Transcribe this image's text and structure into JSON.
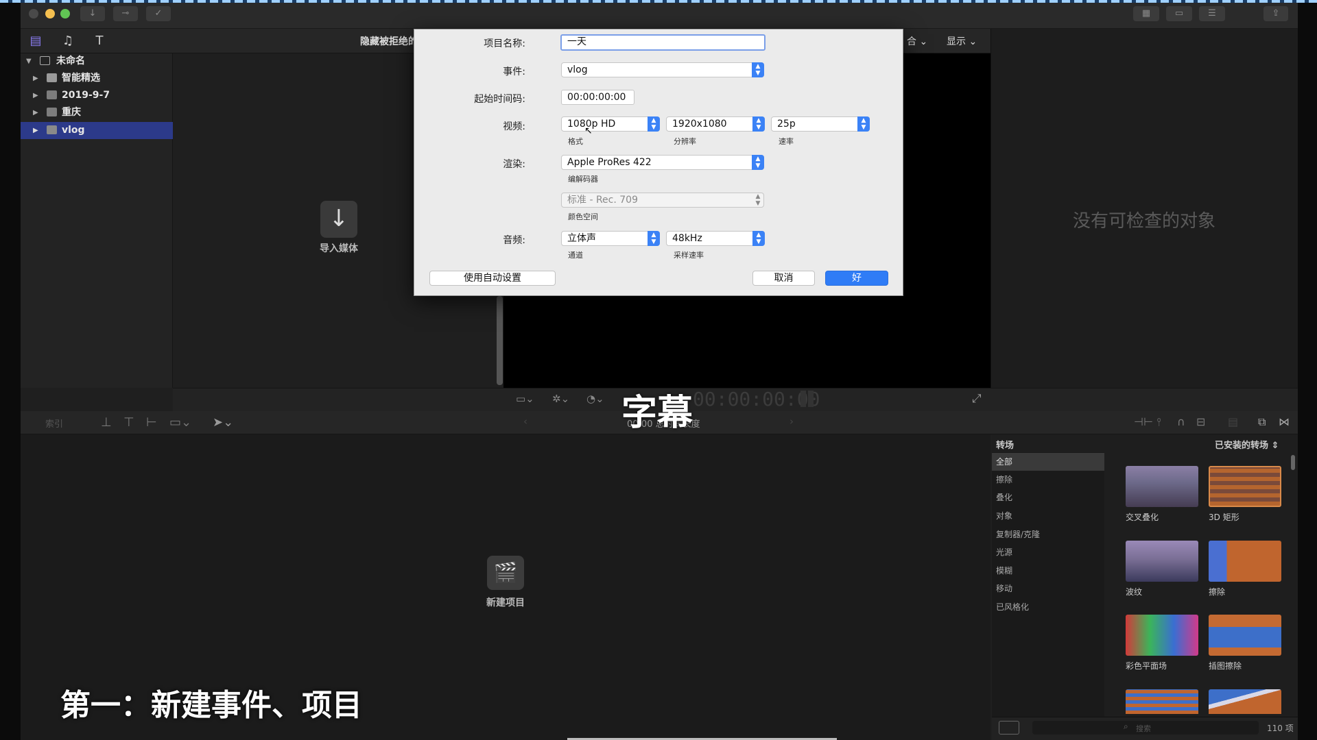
{
  "library": {
    "name": "未命名",
    "items": [
      {
        "label": "智能精选"
      },
      {
        "label": "2019-9-7"
      },
      {
        "label": "重庆"
      },
      {
        "label": "vlog"
      }
    ]
  },
  "browser": {
    "hide_rejected": "隐藏被拒绝的",
    "import_media": "导入媒体"
  },
  "viewer": {
    "combine": "合",
    "display": "显示",
    "timecode": "00:00:00:00",
    "duration": "00:00 总时间长度"
  },
  "inspector": {
    "empty": "没有可检查的对象"
  },
  "timeline": {
    "index": "索引",
    "new_project": "新建项目"
  },
  "dialog": {
    "project_name_label": "项目名称:",
    "project_name_value": "一天",
    "event_label": "事件:",
    "event_value": "vlog",
    "start_tc_label": "起始时间码:",
    "start_tc_value": "00:00:00:00",
    "video_label": "视频:",
    "video_format": "1080p HD",
    "video_format_sub": "格式",
    "video_resolution": "1920x1080",
    "video_resolution_sub": "分辨率",
    "video_rate": "25p",
    "video_rate_sub": "速率",
    "render_label": "渲染:",
    "render_codec": "Apple ProRes 422",
    "render_codec_sub": "编解码器",
    "color_space": "标准 - Rec. 709",
    "color_space_sub": "颜色空间",
    "audio_label": "音频:",
    "audio_channels": "立体声",
    "audio_channels_sub": "通道",
    "audio_rate": "48kHz",
    "audio_rate_sub": "采样速率",
    "auto_settings": "使用自动设置",
    "cancel": "取消",
    "ok": "好"
  },
  "transitions": {
    "title": "转场",
    "installed": "已安装的转场",
    "categories": [
      "全部",
      "擦除",
      "叠化",
      "对象",
      "复制器/克隆",
      "光源",
      "模糊",
      "移动",
      "已风格化"
    ],
    "thumbs": [
      {
        "label": "交叉叠化"
      },
      {
        "label": "3D 矩形"
      },
      {
        "label": "波纹"
      },
      {
        "label": "擦除"
      },
      {
        "label": "彩色平面场"
      },
      {
        "label": "插图擦除"
      }
    ],
    "search_placeholder": "搜索",
    "count": "110 项"
  },
  "captions": {
    "top": "字幕",
    "bottom": "第一：新建事件、项目"
  },
  "colors": {
    "accent": "#2f7cf6",
    "selection": "#2c3a8a"
  }
}
